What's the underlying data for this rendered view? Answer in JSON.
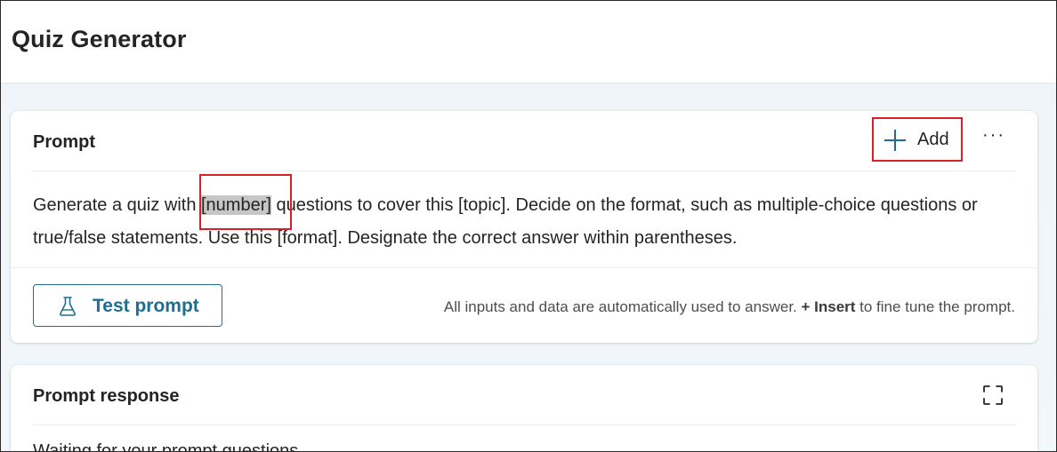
{
  "app": {
    "title": "Quiz Generator"
  },
  "prompt_card": {
    "title": "Prompt",
    "add_label": "Add",
    "more_label": "···",
    "text_before": "Generate a quiz with ",
    "token_number": "[number]",
    "text_after": " questions to cover this [topic]. Decide on the format, such as multiple-choice questions or true/false statements. Use this [format]. Designate the correct answer within parentheses.",
    "test_button_label": "Test prompt",
    "hint_before": "All inputs and data are automatically used to answer. ",
    "hint_insert": "+ Insert",
    "hint_after": " to fine tune the prompt."
  },
  "response_card": {
    "title": "Prompt response",
    "partial_text": "Waiting for your prompt questions..."
  },
  "colors": {
    "accent": "#1f6e91",
    "annotation_red": "#d6202a",
    "token_highlight": "#c6c6c6"
  },
  "icons": {
    "add": "plus-icon",
    "more": "more-horizontal-icon",
    "test": "flask-icon",
    "expand": "expand-icon"
  }
}
